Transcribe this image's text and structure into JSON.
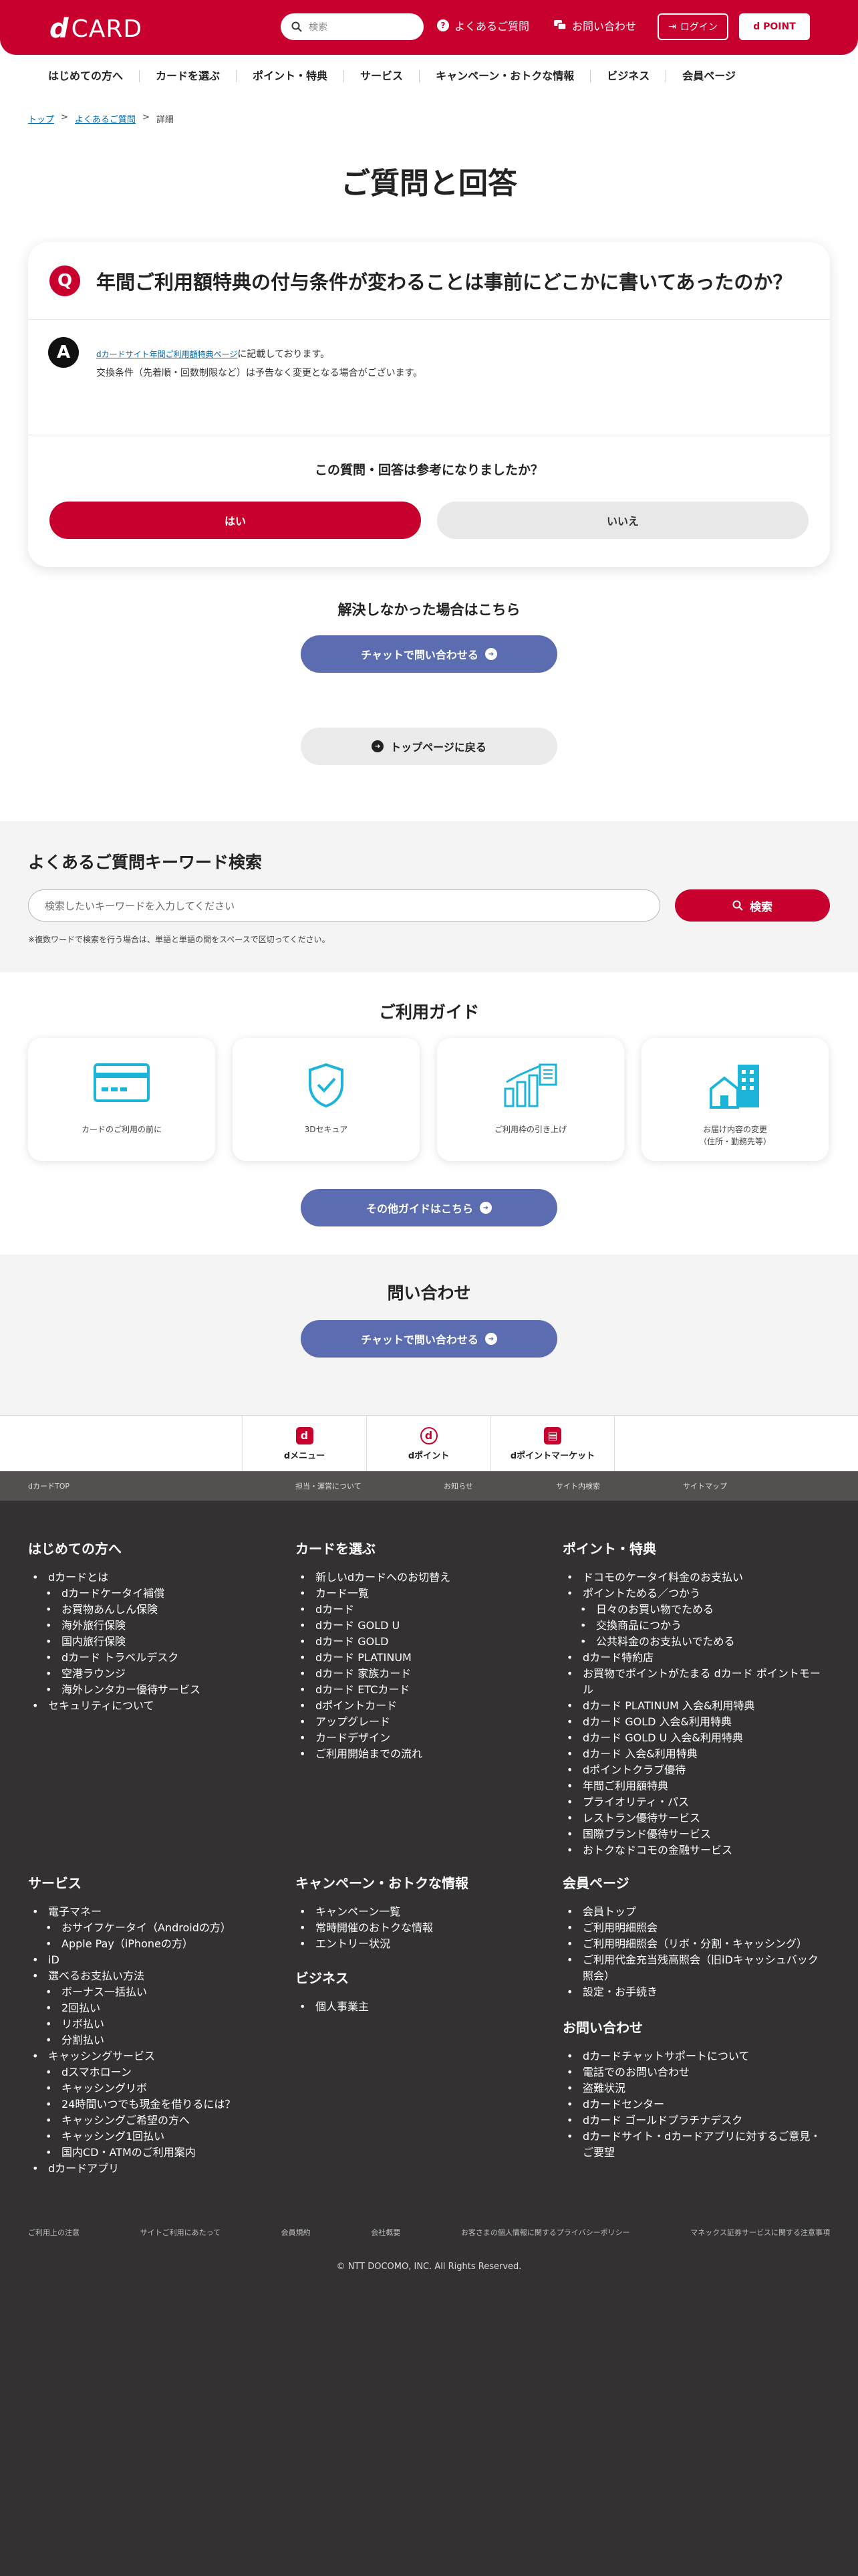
{
  "header": {
    "logo_mark": "d",
    "logo_text": "CARD",
    "search_placeholder": "検索",
    "faq_link": "よくあるご質問",
    "contact_link": "お問い合わせ",
    "login_button": "ログイン",
    "dpoint_button": "d POINT",
    "brand_color": "#c8002e"
  },
  "gnav": [
    "はじめての方へ",
    "カードを選ぶ",
    "ポイント・特典",
    "サービス",
    "キャンペーン・おトクな情報",
    "ビジネス",
    "会員ページ"
  ],
  "breadcrumb": {
    "top": "トップ",
    "faq": "よくあるご質問",
    "current": "詳細",
    "sep": ">"
  },
  "page_title": "ご質問と回答",
  "qa": {
    "q_badge": "Q",
    "question": "年間ご利用額特典の付与条件が変わることは事前にどこかに書いてあったのか？",
    "a_badge": "A",
    "answer_link": "dカードサイト年間ご利用額特典ページ",
    "answer_line1_suffix": "に記載しております。",
    "answer_line2": "交換条件（先着順・回数制限など）は予告なく変更となる場合がございます。",
    "feedback_title": "この質問・回答は参考になりましたか？",
    "yes": "はい",
    "no": "いいえ"
  },
  "unresolved": {
    "title": "解決しなかった場合はこちら",
    "chat_button": "チャットで問い合わせる",
    "back_button": "トップページに戻る"
  },
  "keyword_search": {
    "title": "よくあるご質問キーワード検索",
    "placeholder": "検索したいキーワードを入力してください",
    "button": "検索",
    "note": "※複数ワードで検索を行う場合は、単語と単語の間をスペースで区切ってください。"
  },
  "guide": {
    "title": "ご利用ガイド",
    "items": [
      {
        "icon": "credit-card-icon",
        "label": "カードのご利用の前に",
        "label2": ""
      },
      {
        "icon": "shield-check-icon",
        "label": "3Dセキュア",
        "label2": ""
      },
      {
        "icon": "chart-document-icon",
        "label": "ご利用枠の引き上げ",
        "label2": ""
      },
      {
        "icon": "house-building-icon",
        "label": "お届け内容の変更",
        "label2": "（住所・勤務先等）"
      }
    ],
    "more_button": "その他ガイドはこちら"
  },
  "contact": {
    "title": "問い合わせ",
    "chat_button": "チャットで問い合わせる"
  },
  "services": [
    {
      "icon": "d",
      "label": "dメニュー"
    },
    {
      "icon": "d",
      "label": "dポイント"
    },
    {
      "icon": "▤",
      "label": "dポイントマーケット"
    }
  ],
  "util_links": [
    "dカードTOP",
    "担当・運営について",
    "お知らせ",
    "サイト内検索",
    "サイトマップ"
  ],
  "footer": {
    "col1": {
      "title": "はじめての方へ",
      "items": [
        {
          "text": "dカードとは",
          "sub": false
        },
        {
          "text": "dカードケータイ補償",
          "sub": true
        },
        {
          "text": "お買物あんしん保険",
          "sub": true
        },
        {
          "text": "海外旅行保険",
          "sub": true
        },
        {
          "text": "国内旅行保険",
          "sub": true
        },
        {
          "text": "dカード トラベルデスク",
          "sub": true
        },
        {
          "text": "空港ラウンジ",
          "sub": true
        },
        {
          "text": "海外レンタカー優待サービス",
          "sub": true
        },
        {
          "text": "セキュリティについて",
          "sub": false
        }
      ]
    },
    "col2": {
      "title": "カードを選ぶ",
      "items": [
        {
          "text": "新しいdカードへのお切替え",
          "sub": false
        },
        {
          "text": "カード一覧",
          "sub": false
        },
        {
          "text": "dカード",
          "sub": false
        },
        {
          "text": "dカード GOLD U",
          "sub": false
        },
        {
          "text": "dカード GOLD",
          "sub": false
        },
        {
          "text": "dカード PLATINUM",
          "sub": false
        },
        {
          "text": "dカード 家族カード",
          "sub": false
        },
        {
          "text": "dカード ETCカード",
          "sub": false
        },
        {
          "text": "dポイントカード",
          "sub": false
        },
        {
          "text": "アップグレード",
          "sub": false
        },
        {
          "text": "カードデザイン",
          "sub": false
        },
        {
          "text": "ご利用開始までの流れ",
          "sub": false
        }
      ]
    },
    "col3": {
      "title": "ポイント・特典",
      "items": [
        {
          "text": "ドコモのケータイ料金のお支払い",
          "sub": false
        },
        {
          "text": "ポイントためる／つかう",
          "sub": false
        },
        {
          "text": "日々のお買い物でためる",
          "sub": true
        },
        {
          "text": "交換商品につかう",
          "sub": true
        },
        {
          "text": "公共料金のお支払いでためる",
          "sub": true
        },
        {
          "text": "dカード特約店",
          "sub": false
        },
        {
          "text": "お買物でポイントがたまる dカード ポイントモール",
          "sub": false
        },
        {
          "text": "dカード PLATINUM 入会&利用特典",
          "sub": false
        },
        {
          "text": "dカード GOLD 入会&利用特典",
          "sub": false
        },
        {
          "text": "dカード GOLD U 入会&利用特典",
          "sub": false
        },
        {
          "text": "dカード 入会&利用特典",
          "sub": false
        },
        {
          "text": "dポイントクラブ優待",
          "sub": false
        },
        {
          "text": "年間ご利用額特典",
          "sub": false
        },
        {
          "text": "プライオリティ・パス",
          "sub": false
        },
        {
          "text": "レストラン優待サービス",
          "sub": false
        },
        {
          "text": "国際ブランド優待サービス",
          "sub": false
        },
        {
          "text": "おトクなドコモの金融サービス",
          "sub": false
        }
      ]
    },
    "col4": {
      "title": "サービス",
      "items": [
        {
          "text": "電子マネー",
          "sub": false
        },
        {
          "text": "おサイフケータイ（Androidの方）",
          "sub": true
        },
        {
          "text": "Apple Pay（iPhoneの方）",
          "sub": true
        },
        {
          "text": "iD",
          "sub": false
        },
        {
          "text": "選べるお支払い方法",
          "sub": false
        },
        {
          "text": "ボーナス一括払い",
          "sub": true
        },
        {
          "text": "2回払い",
          "sub": true
        },
        {
          "text": "リボ払い",
          "sub": true
        },
        {
          "text": "分割払い",
          "sub": true
        },
        {
          "text": "キャッシングサービス",
          "sub": false
        },
        {
          "text": "dスマホローン",
          "sub": true
        },
        {
          "text": "キャッシングリボ",
          "sub": true
        },
        {
          "text": "24時間いつでも現金を借りるには？",
          "sub": true
        },
        {
          "text": "キャッシングご希望の方へ",
          "sub": true
        },
        {
          "text": "キャッシング1回払い",
          "sub": true
        },
        {
          "text": "国内CD・ATMのご利用案内",
          "sub": true
        },
        {
          "text": "dカードアプリ",
          "sub": false
        }
      ]
    },
    "col5": {
      "title": "キャンペーン・おトクな情報",
      "items": [
        {
          "text": "キャンペーン一覧",
          "sub": false
        },
        {
          "text": "常時開催のおトクな情報",
          "sub": false
        },
        {
          "text": "エントリー状況",
          "sub": false
        }
      ]
    },
    "col5b": {
      "title": "ビジネス",
      "items": [
        {
          "text": "個人事業主",
          "sub": false
        }
      ]
    },
    "col6": {
      "title": "会員ページ",
      "items": [
        {
          "text": "会員トップ",
          "sub": false
        },
        {
          "text": "ご利用明細照会",
          "sub": false
        },
        {
          "text": "ご利用明細照会（リボ・分割・キャッシング）",
          "sub": false
        },
        {
          "text": "ご利用代金充当残高照会（旧iDキャッシュバック照会）",
          "sub": false
        },
        {
          "text": "設定・お手続き",
          "sub": false
        }
      ]
    },
    "col6b": {
      "title": "お問い合わせ",
      "items": [
        {
          "text": "dカードチャットサポートについて",
          "sub": false
        },
        {
          "text": "電話でのお問い合わせ",
          "sub": false
        },
        {
          "text": "盗難状況",
          "sub": false
        },
        {
          "text": "dカードセンター",
          "sub": false
        },
        {
          "text": "dカード ゴールドプラチナデスク",
          "sub": false
        },
        {
          "text": "dカードサイト・dカードアプリに対するご意見・ご要望",
          "sub": false
        }
      ]
    },
    "bottom_links": [
      "ご利用上の注意",
      "サイトご利用にあたって",
      "会員規約",
      "会社概要",
      "お客さまの個人情報に関するプライバシーポリシー",
      "マネックス証券サービスに関する注意事項"
    ],
    "copyright": "© NTT DOCOMO, INC. All Rights Reserved."
  }
}
